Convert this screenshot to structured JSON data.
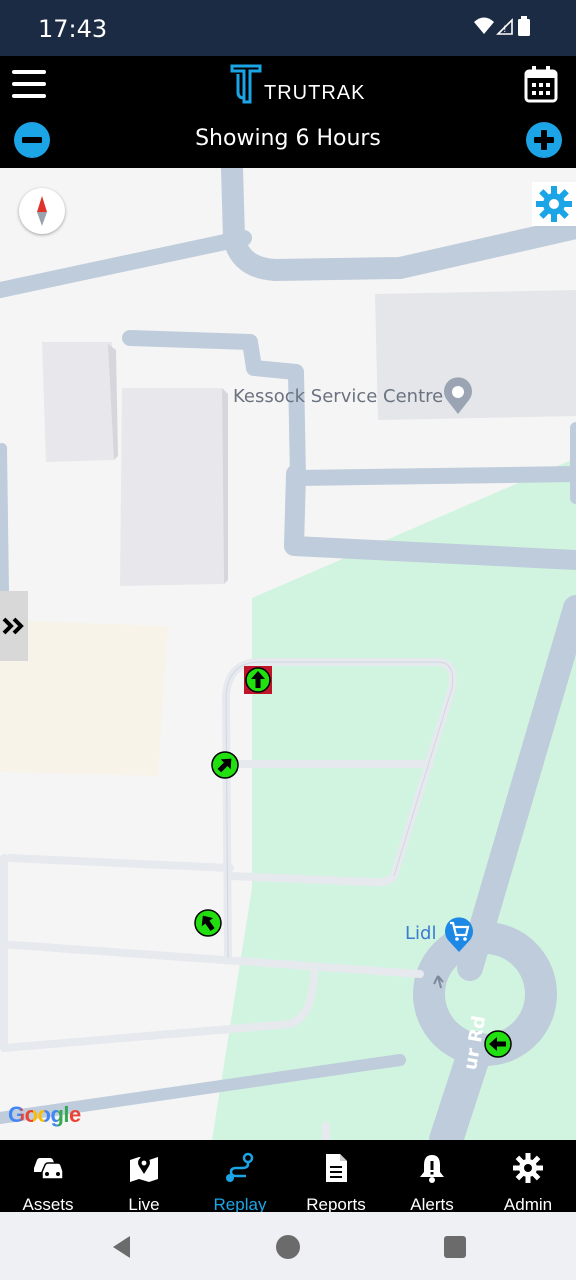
{
  "status_bar": {
    "time": "17:43",
    "icons": [
      "wifi-icon",
      "signal-icon",
      "battery-icon"
    ]
  },
  "header": {
    "logo_text": "TRUTRAK",
    "subtitle": "Showing 6 Hours",
    "icons": {
      "menu": "menu-icon",
      "calendar": "calendar-icon",
      "zoom_out": "minus-circle-icon",
      "zoom_in": "plus-circle-icon"
    }
  },
  "map": {
    "pois": [
      {
        "label": "Kessock Service Centre",
        "icon": "location-pin-icon"
      },
      {
        "label": "Lidl",
        "icon": "shopping-cart-icon"
      }
    ],
    "road_label": "ur Rd",
    "attribution": "Google",
    "trip_markers": [
      {
        "direction": "north",
        "highlighted": true
      },
      {
        "direction": "north-east",
        "highlighted": false
      },
      {
        "direction": "north-west",
        "highlighted": false
      },
      {
        "direction": "west",
        "highlighted": false
      }
    ]
  },
  "bottom_nav": {
    "items": [
      {
        "label": "Assets",
        "icon": "cars-icon",
        "active": false
      },
      {
        "label": "Live",
        "icon": "map-pin-icon",
        "active": false
      },
      {
        "label": "Replay",
        "icon": "route-icon",
        "active": true
      },
      {
        "label": "Reports",
        "icon": "report-icon",
        "active": false
      },
      {
        "label": "Alerts",
        "icon": "bell-alert-icon",
        "active": false
      },
      {
        "label": "Admin",
        "icon": "gear-icon",
        "active": false
      }
    ]
  },
  "colors": {
    "status_bar": "#1c2b44",
    "accent": "#1ca5e6",
    "header_bg": "#000000",
    "marker_green": "#22e010",
    "marker_highlight": "#c0142a",
    "park_green": "#d1f4e0",
    "road": "#bfccdb"
  }
}
